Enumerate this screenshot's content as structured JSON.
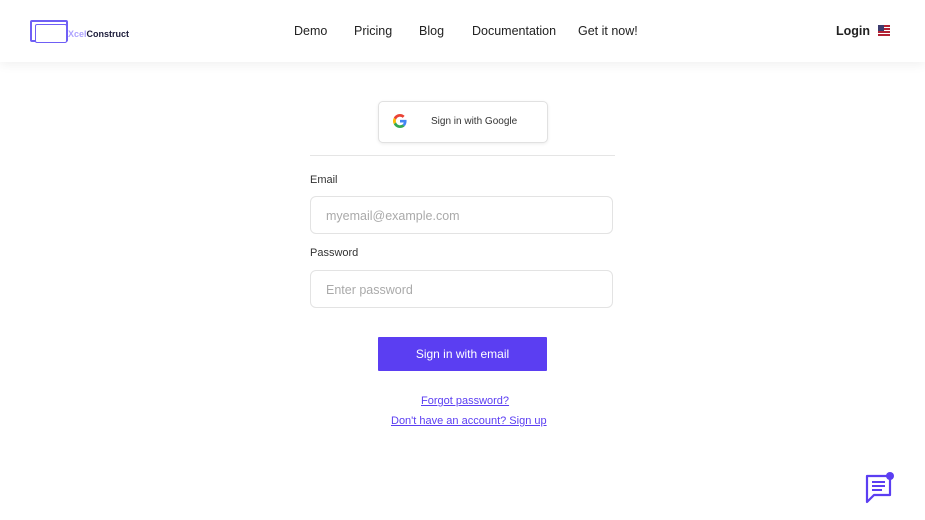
{
  "header": {
    "logo": {
      "prefix": "Xcel",
      "name": "Construct"
    },
    "nav": [
      "Demo",
      "Pricing",
      "Blog",
      "Documentation",
      "Get it now!"
    ],
    "login_label": "Login",
    "language": "us-flag-icon"
  },
  "signin": {
    "google_label": "Sign in with Google",
    "email_label": "Email",
    "email_placeholder": "myemail@example.com",
    "password_label": "Password",
    "password_placeholder": "Enter password",
    "submit_label": "Sign in with email",
    "forgot_label": "Forgot password?",
    "signup_label": "Don't have an account? Sign up"
  },
  "colors": {
    "accent": "#5b3ef2",
    "logo": "#6f5ff5"
  }
}
